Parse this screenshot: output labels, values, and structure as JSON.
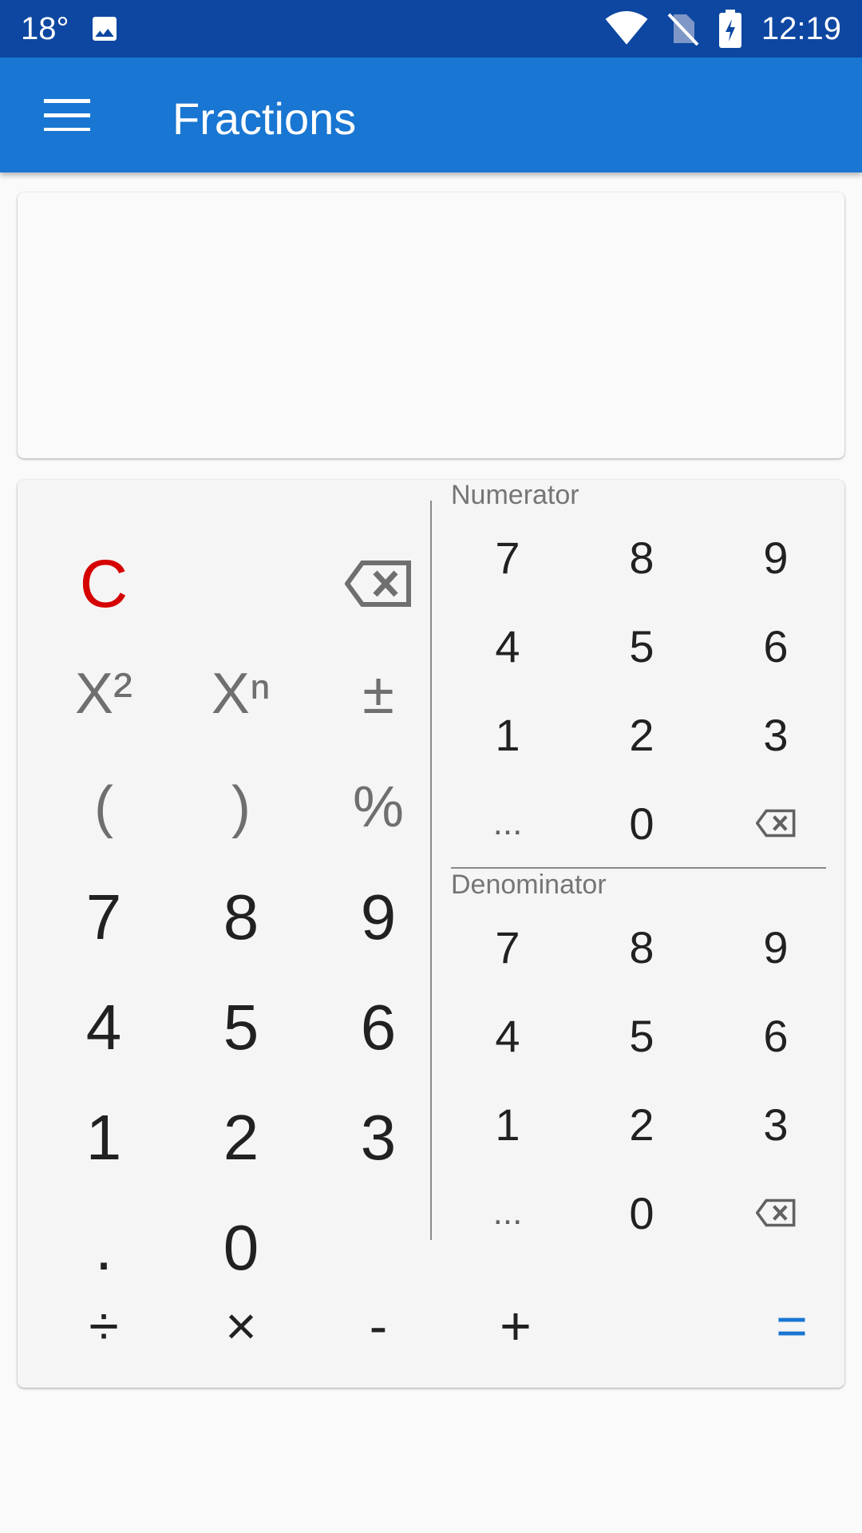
{
  "status_bar": {
    "temperature": "18°",
    "time": "12:19",
    "icons": [
      "image-icon",
      "wifi-icon",
      "no-sim-icon",
      "battery-charging-icon"
    ]
  },
  "app_bar": {
    "title": "Fractions",
    "menu_icon": "hamburger-menu-icon"
  },
  "display": {
    "expression": ""
  },
  "keypad": {
    "clear_label": "C",
    "backspace_icon": "backspace-icon",
    "square_label": "X²",
    "power_label": "Xⁿ",
    "plus_minus_label": "±",
    "open_paren_label": "(",
    "close_paren_label": ")",
    "percent_label": "%",
    "digits": {
      "d7": "7",
      "d8": "8",
      "d9": "9",
      "d4": "4",
      "d5": "5",
      "d6": "6",
      "d1": "1",
      "d2": "2",
      "d3": "3",
      "d0": "0",
      "dot": "."
    },
    "operators": {
      "divide": "÷",
      "multiply": "×",
      "minus": "-",
      "plus": "+",
      "equals": "="
    }
  },
  "numerator": {
    "label": "Numerator",
    "rows": [
      [
        "7",
        "8",
        "9"
      ],
      [
        "4",
        "5",
        "6"
      ],
      [
        "1",
        "2",
        "3"
      ],
      [
        "...",
        "0"
      ]
    ]
  },
  "denominator": {
    "label": "Denominator",
    "rows": [
      [
        "7",
        "8",
        "9"
      ],
      [
        "4",
        "5",
        "6"
      ],
      [
        "1",
        "2",
        "3"
      ],
      [
        "...",
        "0"
      ]
    ]
  },
  "colors": {
    "status_bar": "#0d47a1",
    "app_bar": "#1976d2",
    "clear": "#d50000",
    "equals": "#1976d2"
  }
}
